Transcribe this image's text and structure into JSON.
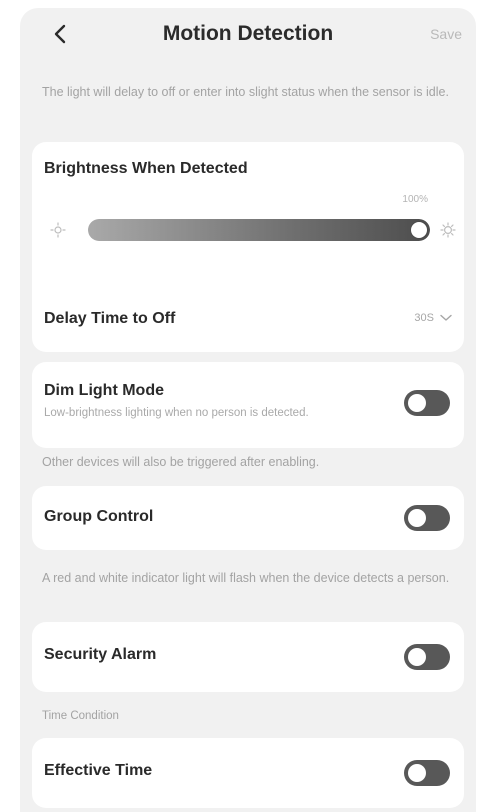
{
  "header": {
    "title": "Motion Detection",
    "save_label": "Save",
    "back_icon": "chevron-left-icon"
  },
  "notes": {
    "top": "The light will delay to off or enter into slight status when the sensor is idle.",
    "other_devices": "Other devices will also be triggered after enabling.",
    "alarm": "A red and white indicator light will flash when the device detects a person.",
    "time_condition": "Time Condition"
  },
  "brightness": {
    "label": "Brightness When Detected",
    "percent_label": "100%",
    "value": 1.0,
    "low_icon": "brightness-low-icon",
    "high_icon": "brightness-high-icon"
  },
  "delay": {
    "label": "Delay Time to Off",
    "value": "30S"
  },
  "dim_light": {
    "label": "Dim Light Mode",
    "sublabel": "Low-brightness lighting when no person is detected.",
    "enabled": false
  },
  "group_control": {
    "label": "Group Control",
    "enabled": false
  },
  "security_alarm": {
    "label": "Security Alarm",
    "enabled": false
  },
  "effective_time": {
    "label": "Effective Time",
    "enabled": false
  }
}
